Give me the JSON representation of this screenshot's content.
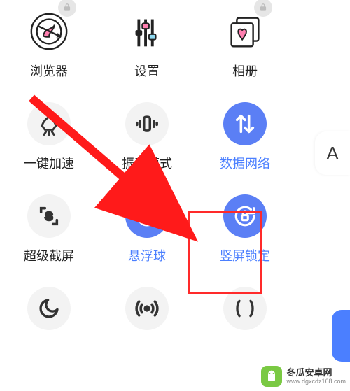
{
  "apps": {
    "browser_label": "浏览器",
    "settings_label": "设置",
    "gallery_label": "相册"
  },
  "toggles": {
    "boost_label": "一键加速",
    "vibrate_label": "振动模式",
    "data_label": "数据网络",
    "supershot_label": "超级截屏",
    "floatball_label": "悬浮球",
    "rotationlock_label": "竖屏锁定"
  },
  "side_tab": "A",
  "watermark": {
    "title": "冬瓜安卓网",
    "url": "www.dgxcdz168.com"
  },
  "colors": {
    "accent": "#5b7ff5",
    "highlight": "#ff2a2a"
  }
}
